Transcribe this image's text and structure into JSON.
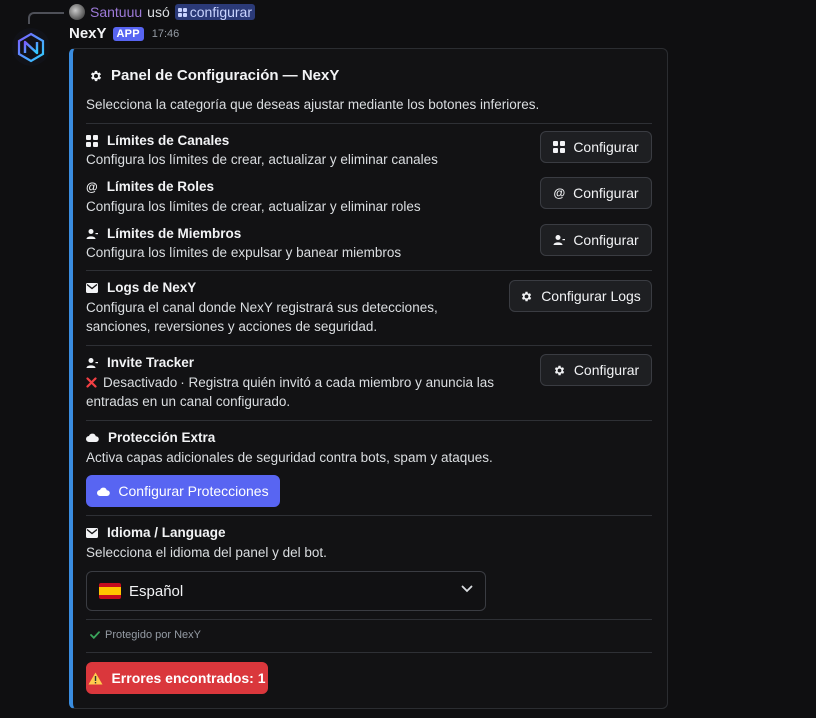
{
  "reply": {
    "user": "Santuuu",
    "verb": "usó",
    "command": "configurar"
  },
  "message": {
    "author": "NexY",
    "tag": "APP",
    "time": "17:46"
  },
  "embed": {
    "accent_color": "#3a8de0",
    "title": "Panel de Configuración — NexY",
    "description": "Selecciona la categoría que deseas ajustar mediante los botones inferiores.",
    "channels": {
      "title": "Límites de Canales",
      "text": "Configura los límites de crear, actualizar y eliminar canales",
      "button": "Configurar",
      "icon": "grid-icon"
    },
    "roles": {
      "title": "Límites de Roles",
      "text": "Configura los límites de crear, actualizar y eliminar roles",
      "button": "Configurar",
      "icon": "at-icon"
    },
    "members": {
      "title": "Límites de Miembros",
      "text": "Configura los límites de expulsar y banear miembros",
      "button": "Configurar",
      "icon": "person-icon"
    },
    "logs": {
      "title": "Logs de NexY",
      "text_line1": "Configura el canal donde NexY registrará sus detecciones,",
      "text_line2": "sanciones, reversiones y acciones de seguridad.",
      "button": "Configurar Logs",
      "icon": "envelope-icon"
    },
    "invite": {
      "title": "Invite Tracker",
      "status": "Desactivado",
      "text_line1": "· Registra quién invitó a cada miembro y anuncia las",
      "text_line2": "entradas en un canal configurado.",
      "button": "Configurar",
      "icon": "person-icon"
    },
    "extra": {
      "title": "Protección Extra",
      "text": "Activa capas adicionales de seguridad contra bots, spam y ataques.",
      "button": "Configurar Protecciones",
      "icon": "cloud-icon"
    },
    "language": {
      "title": "Idioma / Language",
      "text": "Selecciona el idioma del panel y del bot.",
      "selected": "Español",
      "icon": "envelope-icon"
    },
    "footer": "Protegido por NexY",
    "errors_button": "Errores encontrados: 1",
    "colors": {
      "primary": "#5865f2",
      "danger": "#da373c",
      "check": "#3ba55c",
      "cross": "#f23f43"
    }
  }
}
